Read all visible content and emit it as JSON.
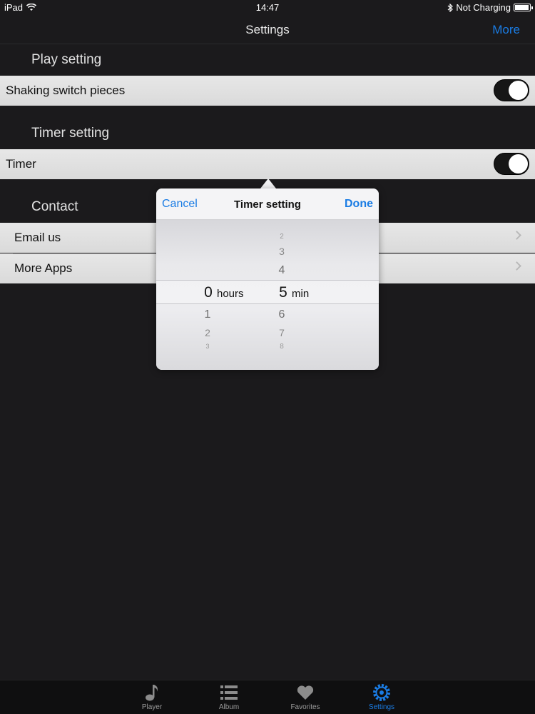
{
  "status_bar": {
    "device": "iPad",
    "time": "14:47",
    "charging": "Not Charging"
  },
  "nav": {
    "title": "Settings",
    "more_label": "More"
  },
  "sections": {
    "play": {
      "header": "Play setting",
      "shaking_label": "Shaking switch pieces",
      "shaking_on": true
    },
    "timer": {
      "header": "Timer setting",
      "timer_label": "Timer",
      "timer_on": true
    },
    "contact": {
      "header": "Contact",
      "email_label": "Email us",
      "more_apps_label": "More Apps"
    }
  },
  "popover": {
    "cancel_label": "Cancel",
    "title": "Timer setting",
    "done_label": "Done",
    "hours": {
      "above": [],
      "selected": "0",
      "below": [
        "1",
        "2",
        "3"
      ],
      "unit": "hours"
    },
    "minutes": {
      "above": [
        "2",
        "3",
        "4"
      ],
      "selected": "5",
      "below": [
        "6",
        "7",
        "8"
      ],
      "unit": "min"
    }
  },
  "tab_bar": {
    "tabs": [
      {
        "label": "Player",
        "icon": "music-note-icon"
      },
      {
        "label": "Album",
        "icon": "list-icon"
      },
      {
        "label": "Favorites",
        "icon": "heart-icon"
      },
      {
        "label": "Settings",
        "icon": "gear-icon"
      }
    ],
    "active_index": 3
  },
  "colors": {
    "accent": "#1a7ce4",
    "background": "#1b1a1c",
    "row": "#e0e0e0"
  }
}
